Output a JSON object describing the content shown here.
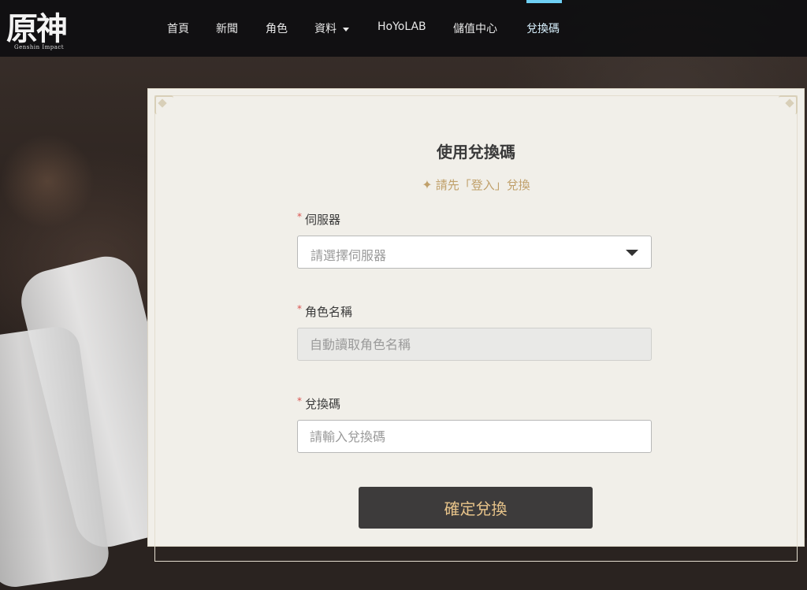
{
  "logo": {
    "main": "原神",
    "sub": "Genshin Impact"
  },
  "nav": {
    "items": [
      {
        "label": "首頁"
      },
      {
        "label": "新聞"
      },
      {
        "label": "角色"
      },
      {
        "label": "資料"
      },
      {
        "label": "HoYoLAB"
      },
      {
        "label": "儲值中心"
      },
      {
        "label": "兌換碼"
      }
    ],
    "active": "兌換碼"
  },
  "form": {
    "title": "使用兌換碼",
    "login_hint": "請先「登入」兌換",
    "server": {
      "label": "伺服器",
      "placeholder": "請選擇伺服器"
    },
    "character": {
      "label": "角色名稱",
      "placeholder": "自動讀取角色名稱"
    },
    "code": {
      "label": "兌換碼",
      "placeholder": "請輸入兌換碼"
    },
    "required_mark": "*",
    "submit_label": "確定兌換"
  },
  "colors": {
    "nav_active_bar": "#6fd0f5",
    "hint": "#c0a06a",
    "button_bg": "#3d3b3b",
    "button_text": "#e8c48a",
    "required": "#d9534f"
  }
}
